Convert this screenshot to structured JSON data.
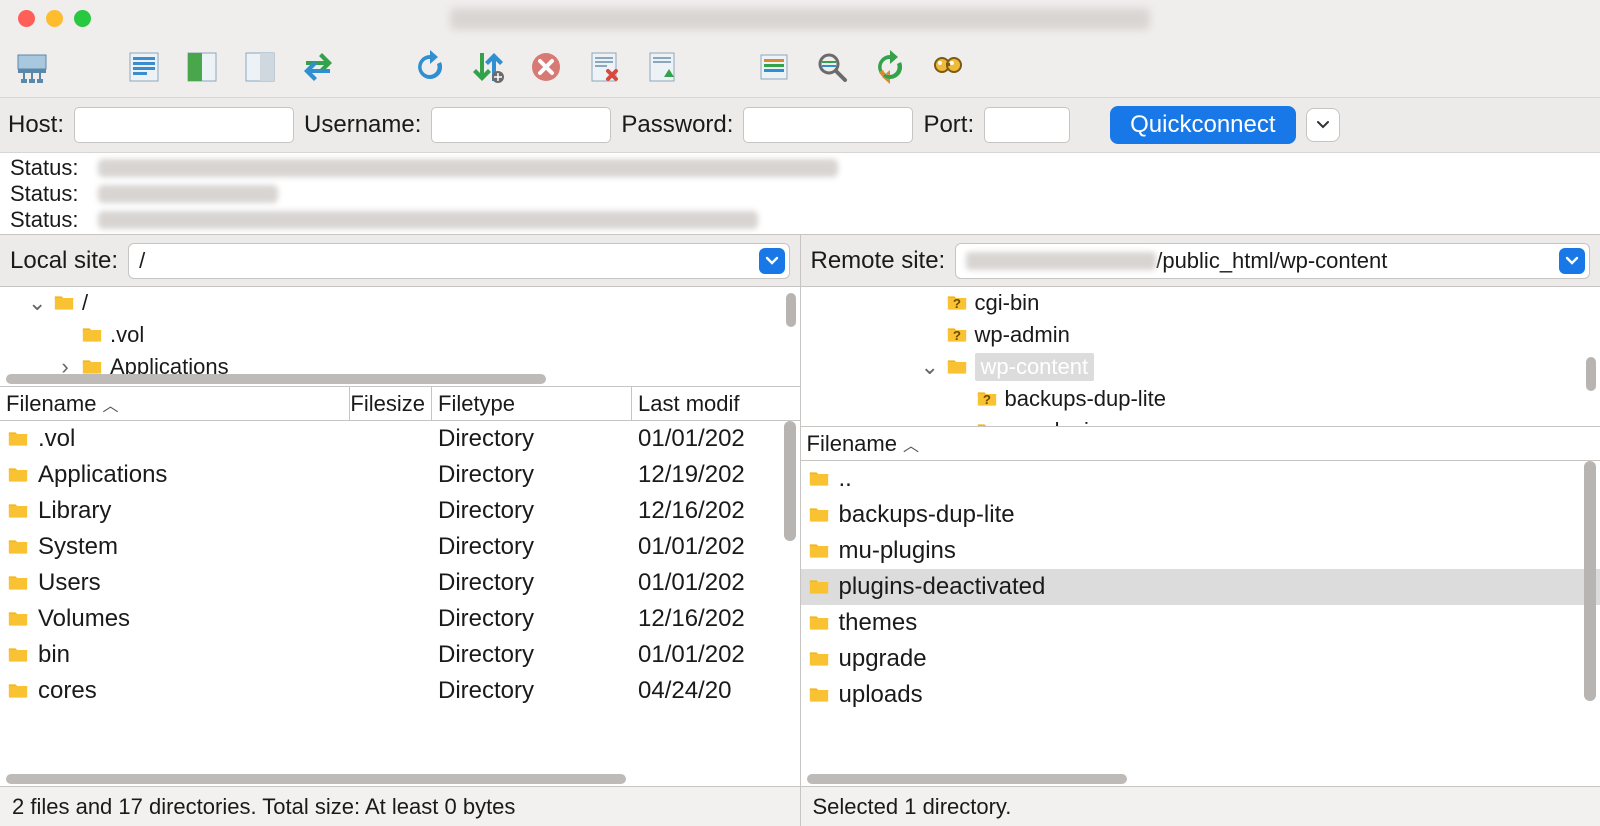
{
  "connect": {
    "host_label": "Host:",
    "host_value": "",
    "user_label": "Username:",
    "user_value": "",
    "pass_label": "Password:",
    "pass_value": "",
    "port_label": "Port:",
    "port_value": "",
    "button": "Quickconnect"
  },
  "log": {
    "label": "Status:"
  },
  "local": {
    "label": "Local site:",
    "path": "/",
    "tree": [
      {
        "indent": 1,
        "disclosure": "down",
        "icon": "folder",
        "name": "/"
      },
      {
        "indent": 2,
        "disclosure": "",
        "icon": "folder",
        "name": ".vol"
      },
      {
        "indent": 2,
        "disclosure": "right",
        "icon": "folder",
        "name": "Applications"
      }
    ],
    "cols": {
      "name": "Filename",
      "size": "Filesize",
      "type": "Filetype",
      "mod": "Last modif"
    },
    "rows": [
      {
        "name": ".vol",
        "size": "",
        "type": "Directory",
        "mod": "01/01/202"
      },
      {
        "name": "Applications",
        "size": "",
        "type": "Directory",
        "mod": "12/19/202"
      },
      {
        "name": "Library",
        "size": "",
        "type": "Directory",
        "mod": "12/16/202"
      },
      {
        "name": "System",
        "size": "",
        "type": "Directory",
        "mod": "01/01/202"
      },
      {
        "name": "Users",
        "size": "",
        "type": "Directory",
        "mod": "01/01/202"
      },
      {
        "name": "Volumes",
        "size": "",
        "type": "Directory",
        "mod": "12/16/202"
      },
      {
        "name": "bin",
        "size": "",
        "type": "Directory",
        "mod": "01/01/202"
      },
      {
        "name": "cores",
        "size": "",
        "type": "Directory",
        "mod": "04/24/20"
      }
    ],
    "status": "2 files and 17 directories. Total size: At least 0 bytes"
  },
  "remote": {
    "label": "Remote site:",
    "path_suffix": "/public_html/wp-content",
    "tree": [
      {
        "indent": 2,
        "disclosure": "",
        "icon": "question",
        "name": "cgi-bin"
      },
      {
        "indent": 2,
        "disclosure": "",
        "icon": "question",
        "name": "wp-admin"
      },
      {
        "indent": 2,
        "disclosure": "down",
        "icon": "folder",
        "name": "wp-content",
        "selected": true
      },
      {
        "indent": 3,
        "disclosure": "",
        "icon": "question",
        "name": "backups-dup-lite"
      },
      {
        "indent": 3,
        "disclosure": "",
        "icon": "question",
        "name": "mu-plugins"
      }
    ],
    "cols": {
      "name": "Filename"
    },
    "rows": [
      {
        "name": "..",
        "selected": false
      },
      {
        "name": "backups-dup-lite",
        "selected": false
      },
      {
        "name": "mu-plugins",
        "selected": false
      },
      {
        "name": "plugins-deactivated",
        "selected": true
      },
      {
        "name": "themes",
        "selected": false
      },
      {
        "name": "upgrade",
        "selected": false
      },
      {
        "name": "uploads",
        "selected": false
      }
    ],
    "status": "Selected 1 directory."
  },
  "icons": {
    "toolbar": [
      "site-manager-icon",
      "",
      "toggle-log-icon",
      "toggle-tree-icon",
      "toggle-remote-tree-icon",
      "sync-browse-icon",
      "",
      "refresh-icon",
      "process-queue-icon",
      "cancel-icon",
      "disconnect-icon",
      "reconnect-icon",
      "",
      "filter-icon",
      "search-icon",
      "compare-icon",
      "find-icon"
    ]
  }
}
